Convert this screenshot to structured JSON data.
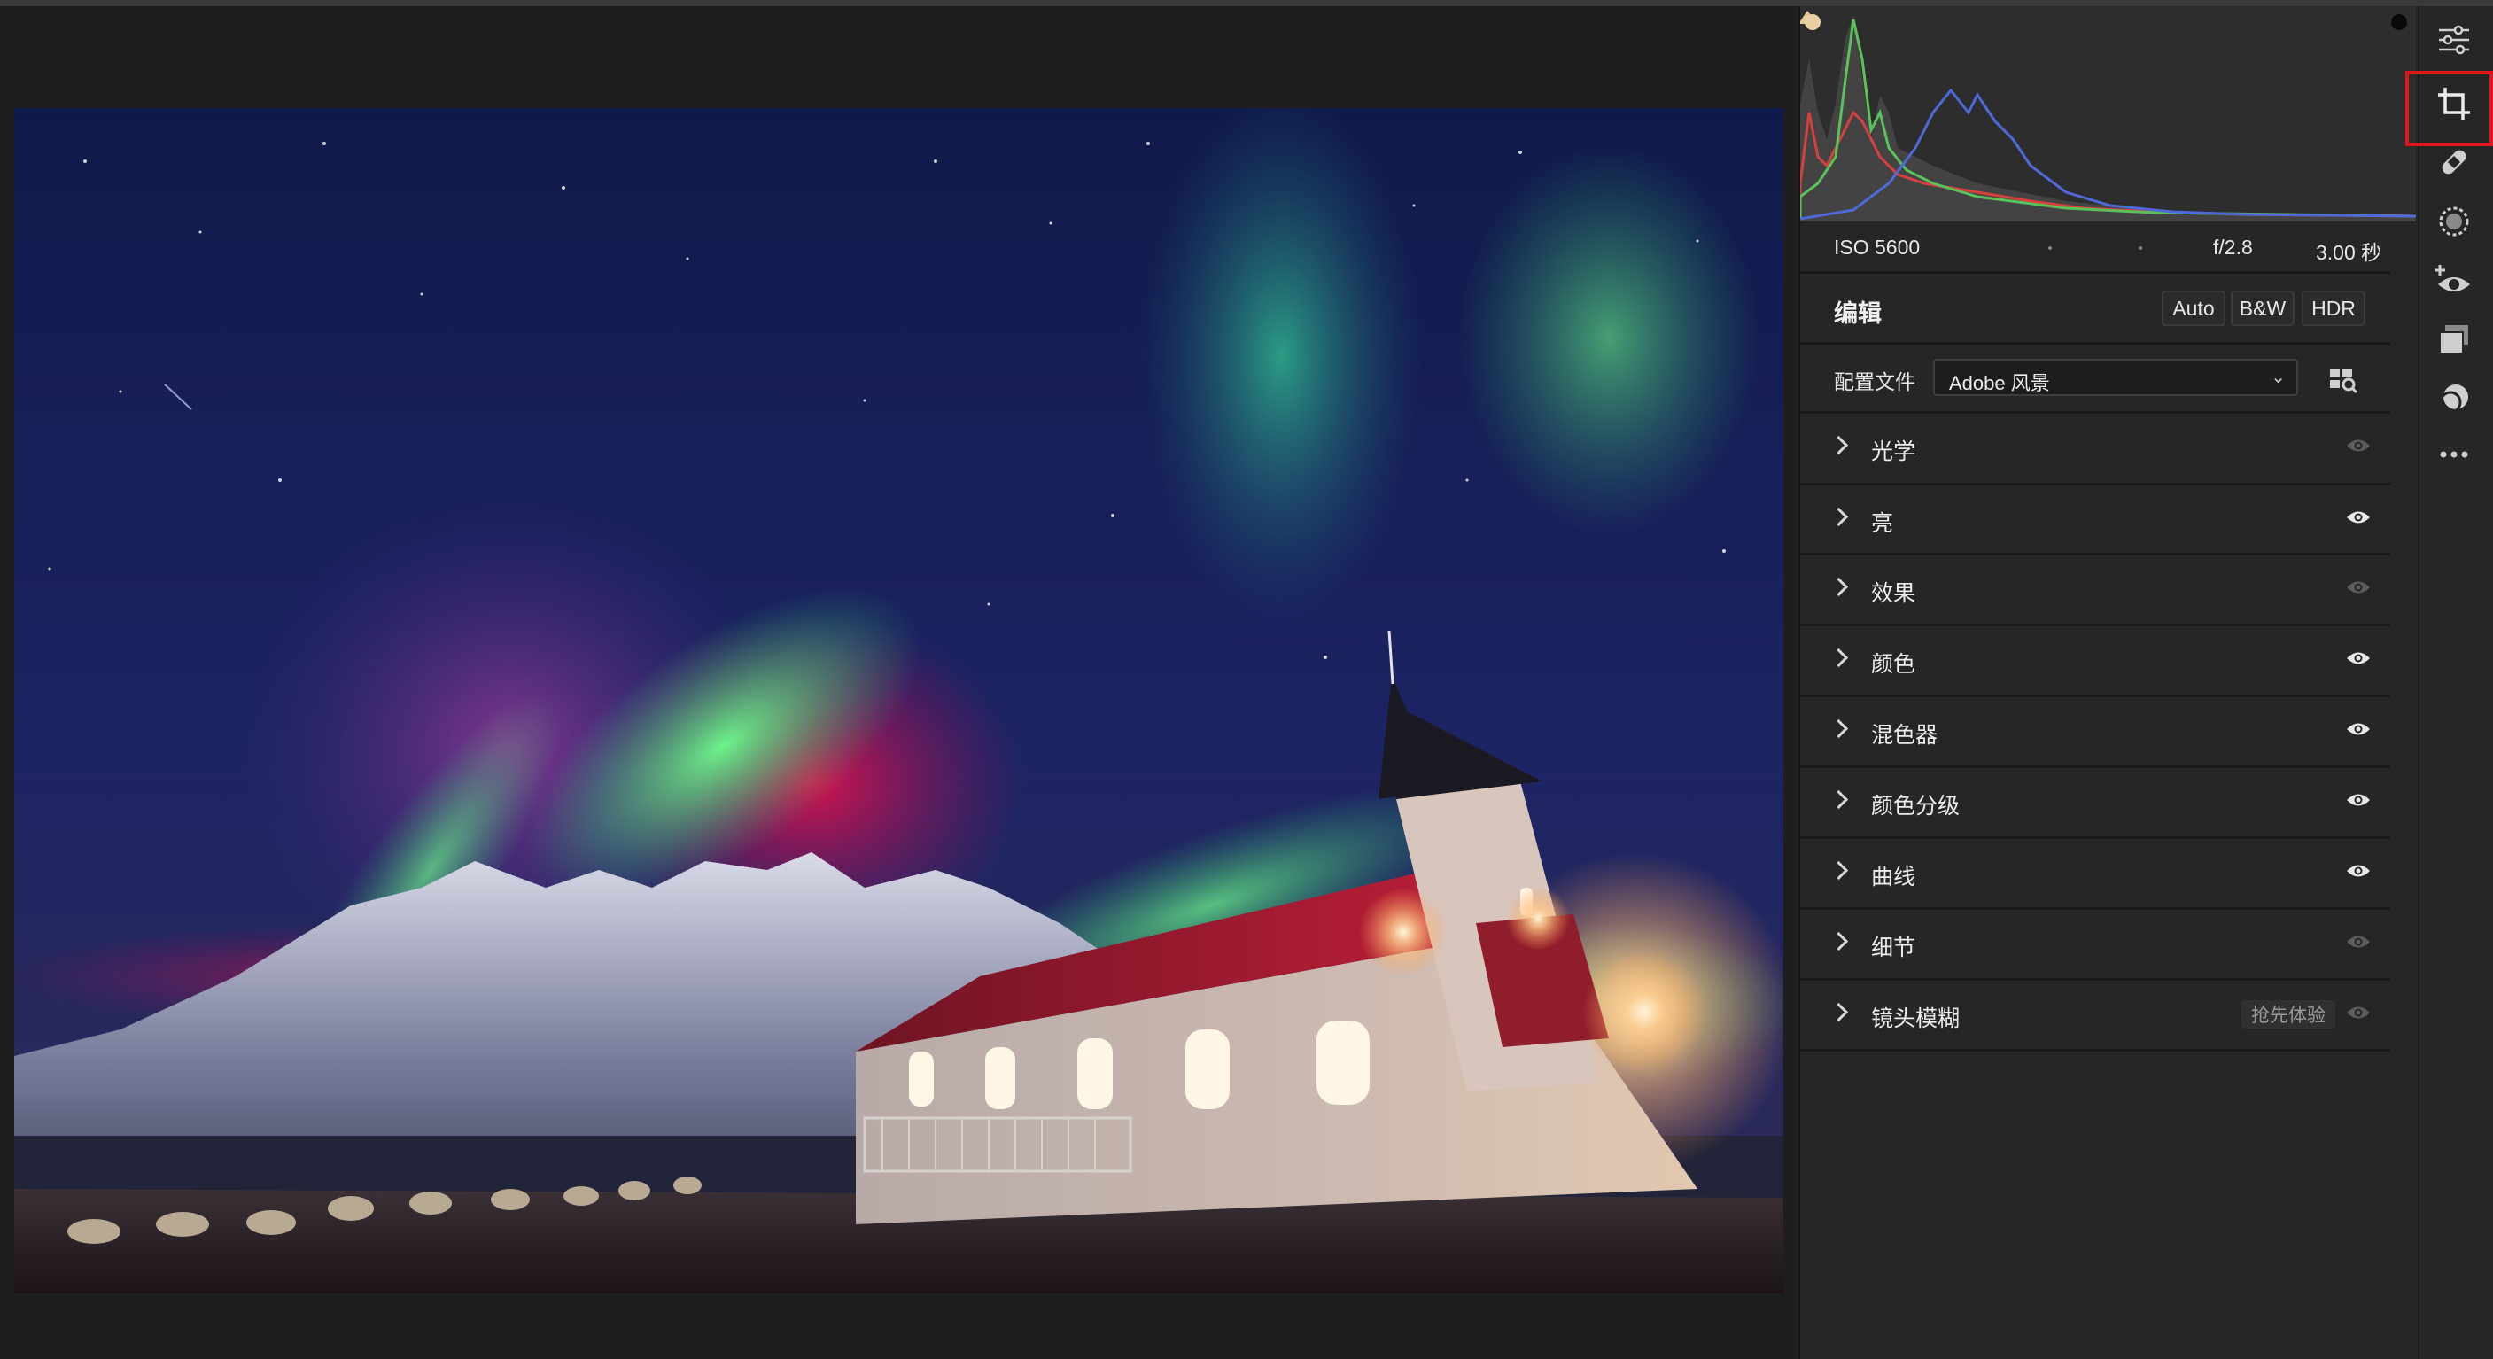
{
  "exif": {
    "iso": "ISO 5600",
    "aperture": "f/2.8",
    "shutter": "3.00 秒"
  },
  "edit": {
    "title": "编辑",
    "buttons": [
      "Auto",
      "B&W",
      "HDR"
    ],
    "profile_label": "配置文件",
    "profile_value": "Adobe 风景"
  },
  "sections": [
    {
      "label": "光学",
      "eye": "dim"
    },
    {
      "label": "亮",
      "eye": "on"
    },
    {
      "label": "效果",
      "eye": "dim"
    },
    {
      "label": "颜色",
      "eye": "on"
    },
    {
      "label": "混色器",
      "eye": "on"
    },
    {
      "label": "颜色分级",
      "eye": "on"
    },
    {
      "label": "曲线",
      "eye": "on"
    },
    {
      "label": "细节",
      "eye": "dim"
    },
    {
      "label": "镜头模糊",
      "eye": "dim",
      "badge": "抢先体验"
    }
  ],
  "toolbar": {
    "tools": [
      "edit-sliders-icon",
      "crop-icon",
      "healing-icon",
      "masking-icon",
      "red-eye-icon",
      "presets-icon",
      "snapshots-icon",
      "more-icon"
    ],
    "highlighted": "crop-icon",
    "highlight_color": "#e0161b"
  },
  "histogram": {
    "red": "#d8403f",
    "green": "#59c25a",
    "blue": "#4f6ad8"
  }
}
